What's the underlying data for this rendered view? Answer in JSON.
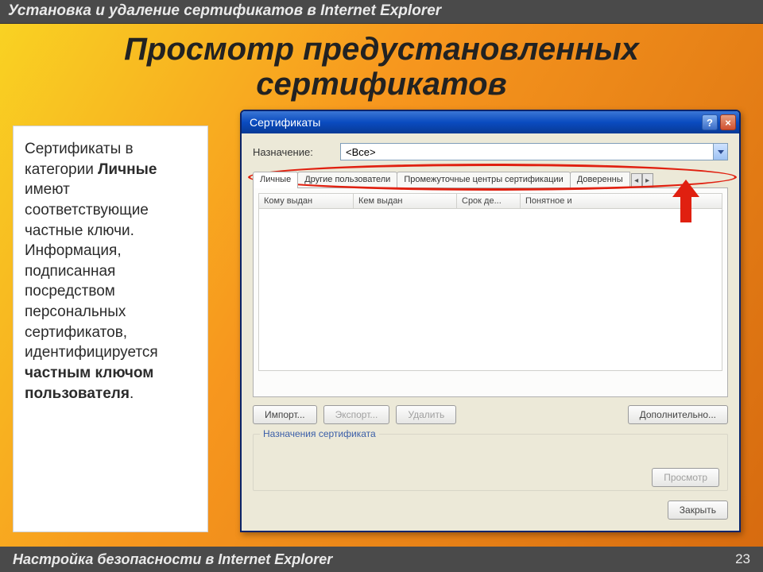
{
  "header": {
    "title": "Установка и удаление сертификатов в Internet Explorer"
  },
  "slide": {
    "title": "Просмотр предустановленных сертификатов"
  },
  "textbox": {
    "pre1": "Сертификаты в категории ",
    "bold1": "Личные",
    "mid": " имеют соответствующие частные ключи. Информация, подписанная посредством персональных сертификатов, идентифицируется ",
    "bold2": "частным ключом пользователя",
    "post": "."
  },
  "dialog": {
    "title": "Сертификаты",
    "purpose_label": "Назначение:",
    "purpose_value": "<Все>",
    "tabs": [
      "Личные",
      "Другие пользователи",
      "Промежуточные центры сертификации",
      "Доверенны"
    ],
    "columns": [
      "Кому выдан",
      "Кем выдан",
      "Срок де...",
      "Понятное и"
    ],
    "buttons": {
      "import": "Импорт...",
      "export": "Экспорт...",
      "delete": "Удалить",
      "advanced": "Дополнительно...",
      "view": "Просмотр",
      "close": "Закрыть"
    },
    "group_legend": "Назначения сертификата"
  },
  "footer": {
    "text": "Настройка безопасности в Internet Explorer",
    "page": "23"
  }
}
